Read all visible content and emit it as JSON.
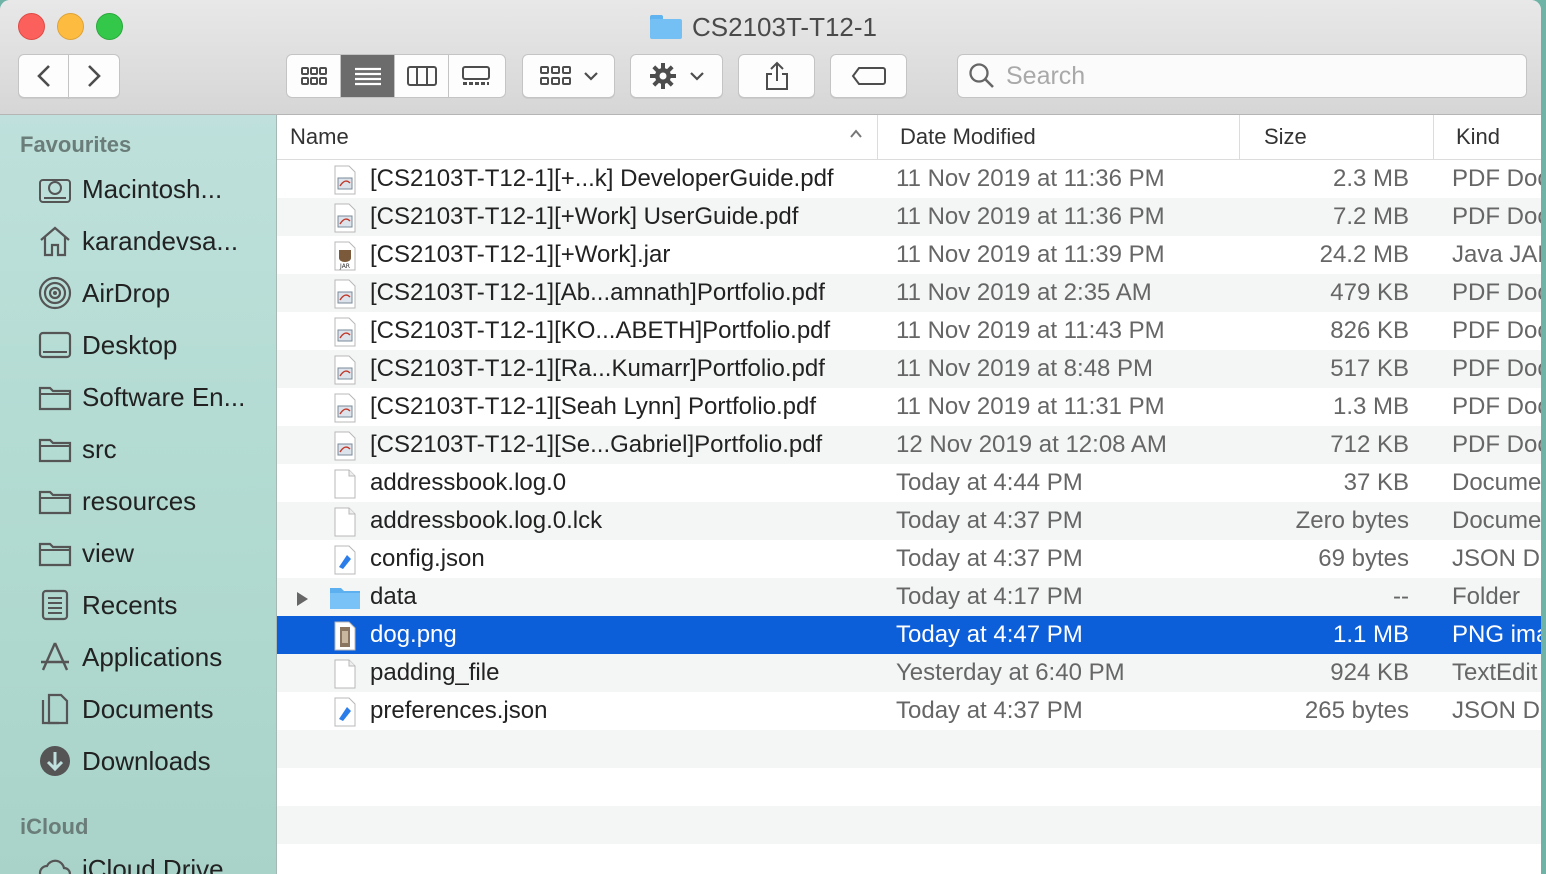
{
  "window": {
    "title": "CS2103T-T12-1"
  },
  "toolbar": {
    "back": "‹",
    "forward": "›",
    "search_placeholder": "Search"
  },
  "sidebar": {
    "favourites_heading": "Favourites",
    "icloud_heading": "iCloud",
    "items": [
      {
        "label": "Macintosh...",
        "icon": "hard-drive-icon"
      },
      {
        "label": "karandevsa...",
        "icon": "home-icon"
      },
      {
        "label": "AirDrop",
        "icon": "airdrop-icon"
      },
      {
        "label": "Desktop",
        "icon": "desktop-icon"
      },
      {
        "label": "Software En...",
        "icon": "folder-icon"
      },
      {
        "label": "src",
        "icon": "folder-icon"
      },
      {
        "label": "resources",
        "icon": "folder-icon"
      },
      {
        "label": "view",
        "icon": "folder-icon"
      },
      {
        "label": "Recents",
        "icon": "recents-icon"
      },
      {
        "label": "Applications",
        "icon": "applications-icon"
      },
      {
        "label": "Documents",
        "icon": "documents-icon"
      },
      {
        "label": "Downloads",
        "icon": "downloads-icon"
      }
    ],
    "icloud_items": [
      {
        "label": "iCloud Drive",
        "icon": "cloud-icon"
      }
    ]
  },
  "columns": {
    "name": "Name",
    "date": "Date Modified",
    "size": "Size",
    "kind": "Kind"
  },
  "files": [
    {
      "name": "[CS2103T-T12-1][+...k] DeveloperGuide.pdf",
      "date": "11 Nov 2019 at 11:36 PM",
      "size": "2.3 MB",
      "kind": "PDF Doc",
      "icon": "pdf-icon"
    },
    {
      "name": "[CS2103T-T12-1][+Work] UserGuide.pdf",
      "date": "11 Nov 2019 at 11:36 PM",
      "size": "7.2 MB",
      "kind": "PDF Doc",
      "icon": "pdf-icon"
    },
    {
      "name": "[CS2103T-T12-1][+Work].jar",
      "date": "11 Nov 2019 at 11:39 PM",
      "size": "24.2 MB",
      "kind": "Java JAR",
      "icon": "jar-icon"
    },
    {
      "name": "[CS2103T-T12-1][Ab...amnath]Portfolio.pdf",
      "date": "11 Nov 2019 at 2:35 AM",
      "size": "479 KB",
      "kind": "PDF Doc",
      "icon": "pdf-icon"
    },
    {
      "name": "[CS2103T-T12-1][KO...ABETH]Portfolio.pdf",
      "date": "11 Nov 2019 at 11:43 PM",
      "size": "826 KB",
      "kind": "PDF Doc",
      "icon": "pdf-icon"
    },
    {
      "name": "[CS2103T-T12-1][Ra...Kumarr]Portfolio.pdf",
      "date": "11 Nov 2019 at 8:48 PM",
      "size": "517 KB",
      "kind": "PDF Doc",
      "icon": "pdf-icon"
    },
    {
      "name": "[CS2103T-T12-1][Seah Lynn] Portfolio.pdf",
      "date": "11 Nov 2019 at 11:31 PM",
      "size": "1.3 MB",
      "kind": "PDF Doc",
      "icon": "pdf-icon"
    },
    {
      "name": "[CS2103T-T12-1][Se...Gabriel]Portfolio.pdf",
      "date": "12 Nov 2019 at 12:08 AM",
      "size": "712 KB",
      "kind": "PDF Doc",
      "icon": "pdf-icon"
    },
    {
      "name": "addressbook.log.0",
      "date": "Today at 4:44 PM",
      "size": "37 KB",
      "kind": "Docume",
      "icon": "document-icon"
    },
    {
      "name": "addressbook.log.0.lck",
      "date": "Today at 4:37 PM",
      "size": "Zero bytes",
      "kind": "Docume",
      "icon": "document-icon"
    },
    {
      "name": "config.json",
      "date": "Today at 4:37 PM",
      "size": "69 bytes",
      "kind": "JSON D",
      "icon": "json-icon"
    },
    {
      "name": "data",
      "date": "Today at 4:17 PM",
      "size": "--",
      "kind": "Folder",
      "icon": "folder-icon",
      "folder": true
    },
    {
      "name": "dog.png",
      "date": "Today at 4:47 PM",
      "size": "1.1 MB",
      "kind": "PNG ima",
      "icon": "image-icon",
      "selected": true
    },
    {
      "name": "padding_file",
      "date": "Yesterday at 6:40 PM",
      "size": "924 KB",
      "kind": "TextEdit",
      "icon": "document-icon"
    },
    {
      "name": "preferences.json",
      "date": "Today at 4:37 PM",
      "size": "265 bytes",
      "kind": "JSON D",
      "icon": "json-icon"
    }
  ],
  "colors": {
    "selection": "#0d5ed9",
    "sidebar": "#b4dcd3"
  }
}
